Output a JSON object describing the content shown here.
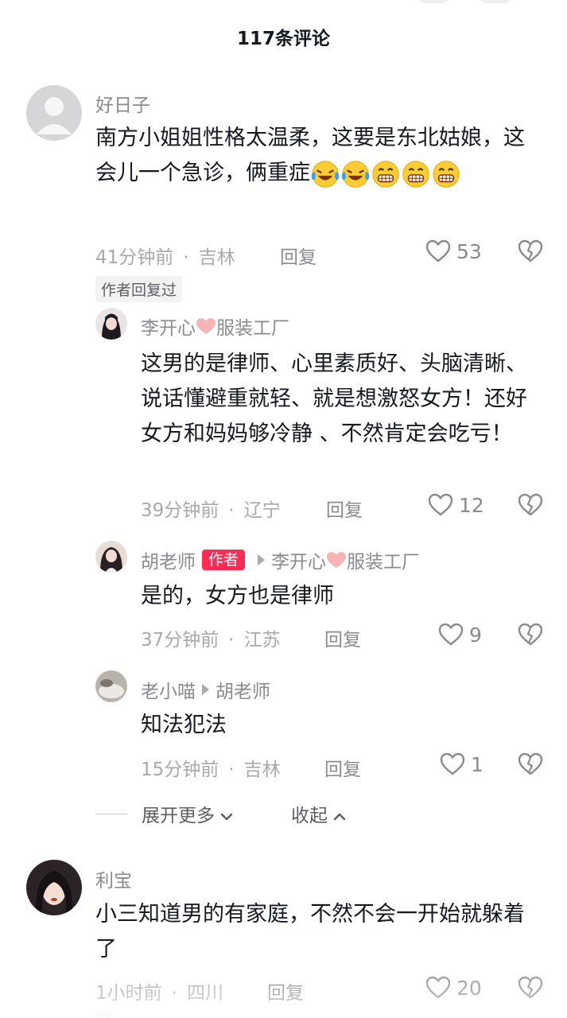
{
  "header": {
    "title": "117条评论"
  },
  "comments": [
    {
      "user": "好日子",
      "text": "南方小姐姐性格太温柔，这要是东北姑娘，这会儿一个急诊，俩重症",
      "time": "41分钟前",
      "location": "吉林",
      "reply_label": "回复",
      "likes": "53",
      "author_replied_badge": "作者回复过",
      "emojis": [
        "laugh-cry-emoji",
        "laugh-cry-emoji",
        "grin-emoji",
        "grin-emoji",
        "grin-emoji"
      ]
    },
    {
      "user": "利宝",
      "text": "小三知道男的有家庭，不然不会一开始就躲着了",
      "time": "1小时前",
      "location": "四川",
      "reply_label": "回复",
      "likes": "20"
    }
  ],
  "replies": [
    {
      "user": "李开心",
      "user_suffix": "服装工厂",
      "text": "这男的是律师、心里素质好、头脑清晰、说话懂避重就轻、就是想激怒女方！还好女方和妈妈够冷静 、不然肯定会吃亏！",
      "time": "39分钟前",
      "location": "辽宁",
      "reply_label": "回复",
      "likes": "12"
    },
    {
      "user": "胡老师",
      "author_tag": "作者",
      "reply_to": "李开心",
      "reply_to_suffix": "服装工厂",
      "text": "是的，女方也是律师",
      "time": "37分钟前",
      "location": "江苏",
      "reply_label": "回复",
      "likes": "9"
    },
    {
      "user": "老小喵",
      "reply_to": "胡老师",
      "text": "知法犯法",
      "time": "15分钟前",
      "location": "吉林",
      "reply_label": "回复",
      "likes": "1"
    }
  ],
  "thread_controls": {
    "expand_more": "展开更多",
    "collapse": "收起"
  },
  "colors": {
    "author_tag": "#fe2c55",
    "text": "#161823",
    "muted": "#8a8b91",
    "heart_pink": "#f8b4b4"
  },
  "icons": [
    "heart-outline-icon",
    "broken-heart-icon",
    "chevron-down-icon",
    "chevron-up-icon",
    "pink-heart-icon",
    "reply-arrow-icon"
  ]
}
